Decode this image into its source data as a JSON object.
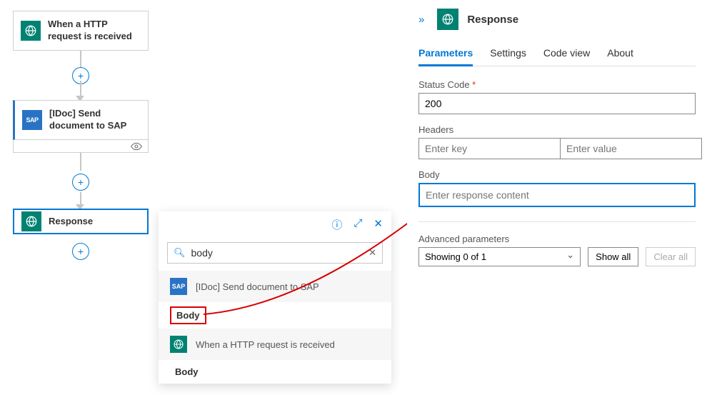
{
  "workflow": {
    "node_http": {
      "label": "When a HTTP request is received"
    },
    "node_sap": {
      "label": "[IDoc] Send document to SAP",
      "brand": "SAP"
    },
    "node_resp": {
      "label": "Response"
    }
  },
  "popup": {
    "search_value": "body",
    "section_sap_label": "[IDoc] Send document to SAP",
    "section_sap_brand": "SAP",
    "body1": "Body",
    "section_http_label": "When a HTTP request is received",
    "body2": "Body"
  },
  "panel": {
    "title": "Response",
    "tabs": {
      "parameters": "Parameters",
      "settings": "Settings",
      "code_view": "Code view",
      "about": "About"
    },
    "status_code_label": "Status Code",
    "status_code_value": "200",
    "headers_label": "Headers",
    "headers_key_placeholder": "Enter key",
    "headers_value_placeholder": "Enter value",
    "body_label": "Body",
    "body_placeholder": "Enter response content",
    "adv_label": "Advanced parameters",
    "adv_select": "Showing 0 of 1",
    "show_all": "Show all",
    "clear_all": "Clear all"
  }
}
